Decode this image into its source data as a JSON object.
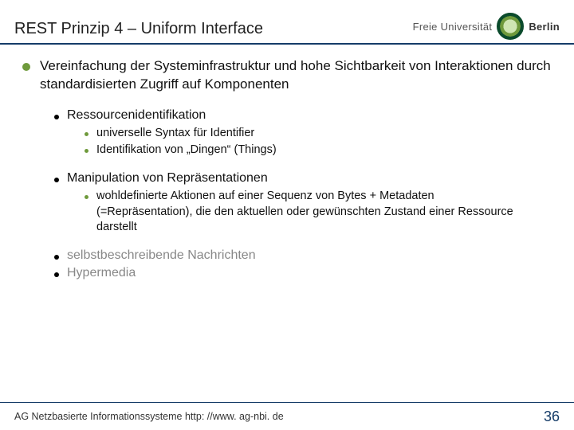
{
  "header": {
    "title": "REST Prinzip 4 – Uniform Interface",
    "logo_text_light": "Freie Universität",
    "logo_text_bold": "Berlin"
  },
  "lead": "Vereinfachung der Systeminfrastruktur und hohe Sichtbarkeit von Interaktionen durch standardisierten Zugriff auf Komponenten",
  "items": [
    {
      "label": "Ressourcenidentifikation",
      "muted": false,
      "children": [
        "universelle Syntax für Identifier",
        "Identifikation von „Dingen“ (Things)"
      ]
    },
    {
      "label": "Manipulation von Repräsentationen",
      "muted": false,
      "children": [
        "wohldefinierte Aktionen auf einer Sequenz von Bytes + Metadaten (=Repräsentation), die den aktuellen oder gewünschten Zustand einer Ressource darstellt"
      ]
    },
    {
      "label": "selbstbeschreibende Nachrichten",
      "muted": true,
      "children": []
    },
    {
      "label": "Hypermedia",
      "muted": true,
      "children": []
    }
  ],
  "footer": {
    "text": "AG Netzbasierte Informationssysteme http: //www. ag-nbi. de",
    "page": "36"
  }
}
